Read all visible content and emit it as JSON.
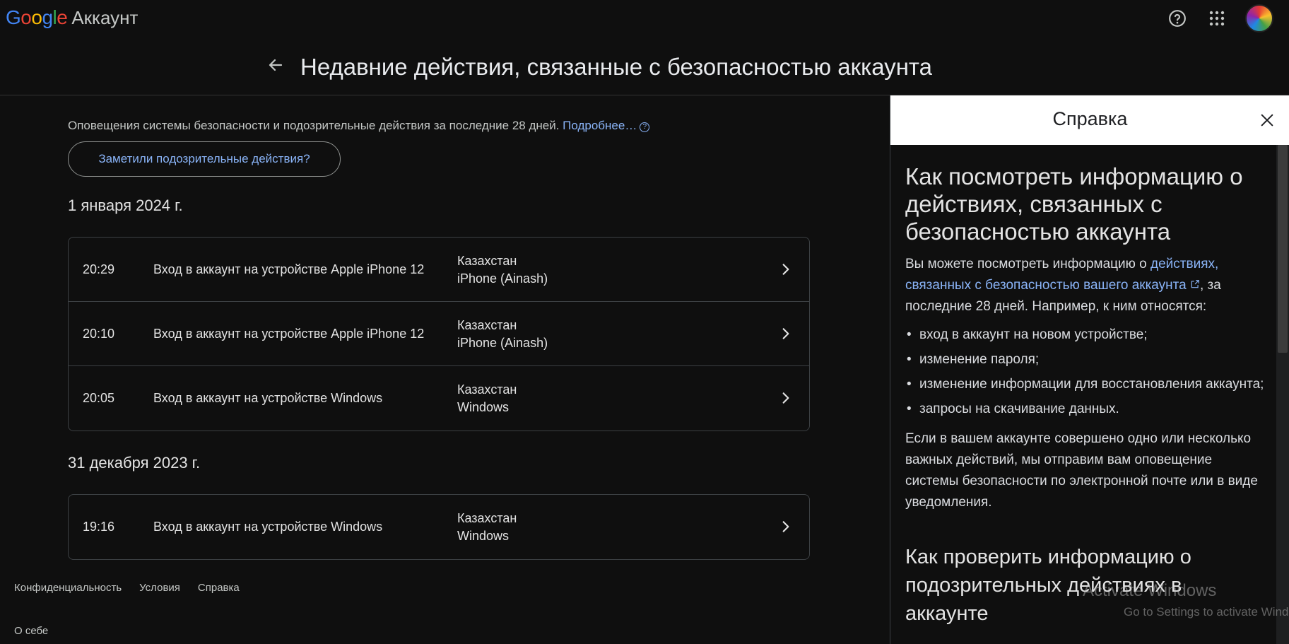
{
  "header": {
    "logo_letters": [
      "G",
      "o",
      "o",
      "g",
      "l",
      "e"
    ],
    "product": "Аккаунт",
    "page_title": "Недавние действия, связанные с безопасностью аккаунта"
  },
  "main": {
    "intro_text": "Оповещения системы безопасности и подозрительные действия за последние 28 дней. ",
    "intro_link": "Подробнее…",
    "suspicious_button": "Заметили подозрительные действия?",
    "groups": [
      {
        "date": "1 января 2024 г.",
        "events": [
          {
            "time": "20:29",
            "description": "Вход в аккаунт на устройстве Apple iPhone 12",
            "location": "Казахстан",
            "device": "iPhone (Ainash)"
          },
          {
            "time": "20:10",
            "description": "Вход в аккаунт на устройстве Apple iPhone 12",
            "location": "Казахстан",
            "device": "iPhone (Ainash)"
          },
          {
            "time": "20:05",
            "description": "Вход в аккаунт на устройстве Windows",
            "location": "Казахстан",
            "device": "Windows"
          }
        ]
      },
      {
        "date": "31 декабря 2023 г.",
        "events": [
          {
            "time": "19:16",
            "description": "Вход в аккаунт на устройстве Windows",
            "location": "Казахстан",
            "device": "Windows"
          }
        ]
      }
    ]
  },
  "footer": {
    "links": [
      "Конфиденциальность",
      "Условия",
      "Справка"
    ],
    "about": "О себе"
  },
  "help": {
    "title": "Справка",
    "heading1": "Как посмотреть информацию о действиях, связанных с безопасностью аккаунта",
    "p1_before": "Вы можете посмотреть информацию о ",
    "p1_link": "действиях, связанных с безопасностью вашего аккаунта",
    "p1_after": ", за последние 28 дней. Например, к ним относятся:",
    "bullets": [
      "вход в аккаунт на новом устройстве;",
      "изменение пароля;",
      "изменение информации для восстановления аккаунта;",
      "запросы на скачивание данных."
    ],
    "p2": "Если в вашем аккаунте совершено одно или несколько важных действий, мы отправим вам оповещение системы безопасности по электронной почте или в виде уведомления.",
    "heading2": "Как проверить информацию о подозрительных действиях в аккаунте"
  },
  "watermark": {
    "line1": "Activate Windows",
    "line2": "Go to Settings to activate Windows."
  },
  "colors": {
    "background": "#0f0f0f",
    "link": "#8ab4f8",
    "border": "#3c4043"
  },
  "icons": [
    "help-circle-icon",
    "apps-grid-icon",
    "arrow-back-icon",
    "chevron-right-icon",
    "close-icon",
    "external-link-icon"
  ]
}
